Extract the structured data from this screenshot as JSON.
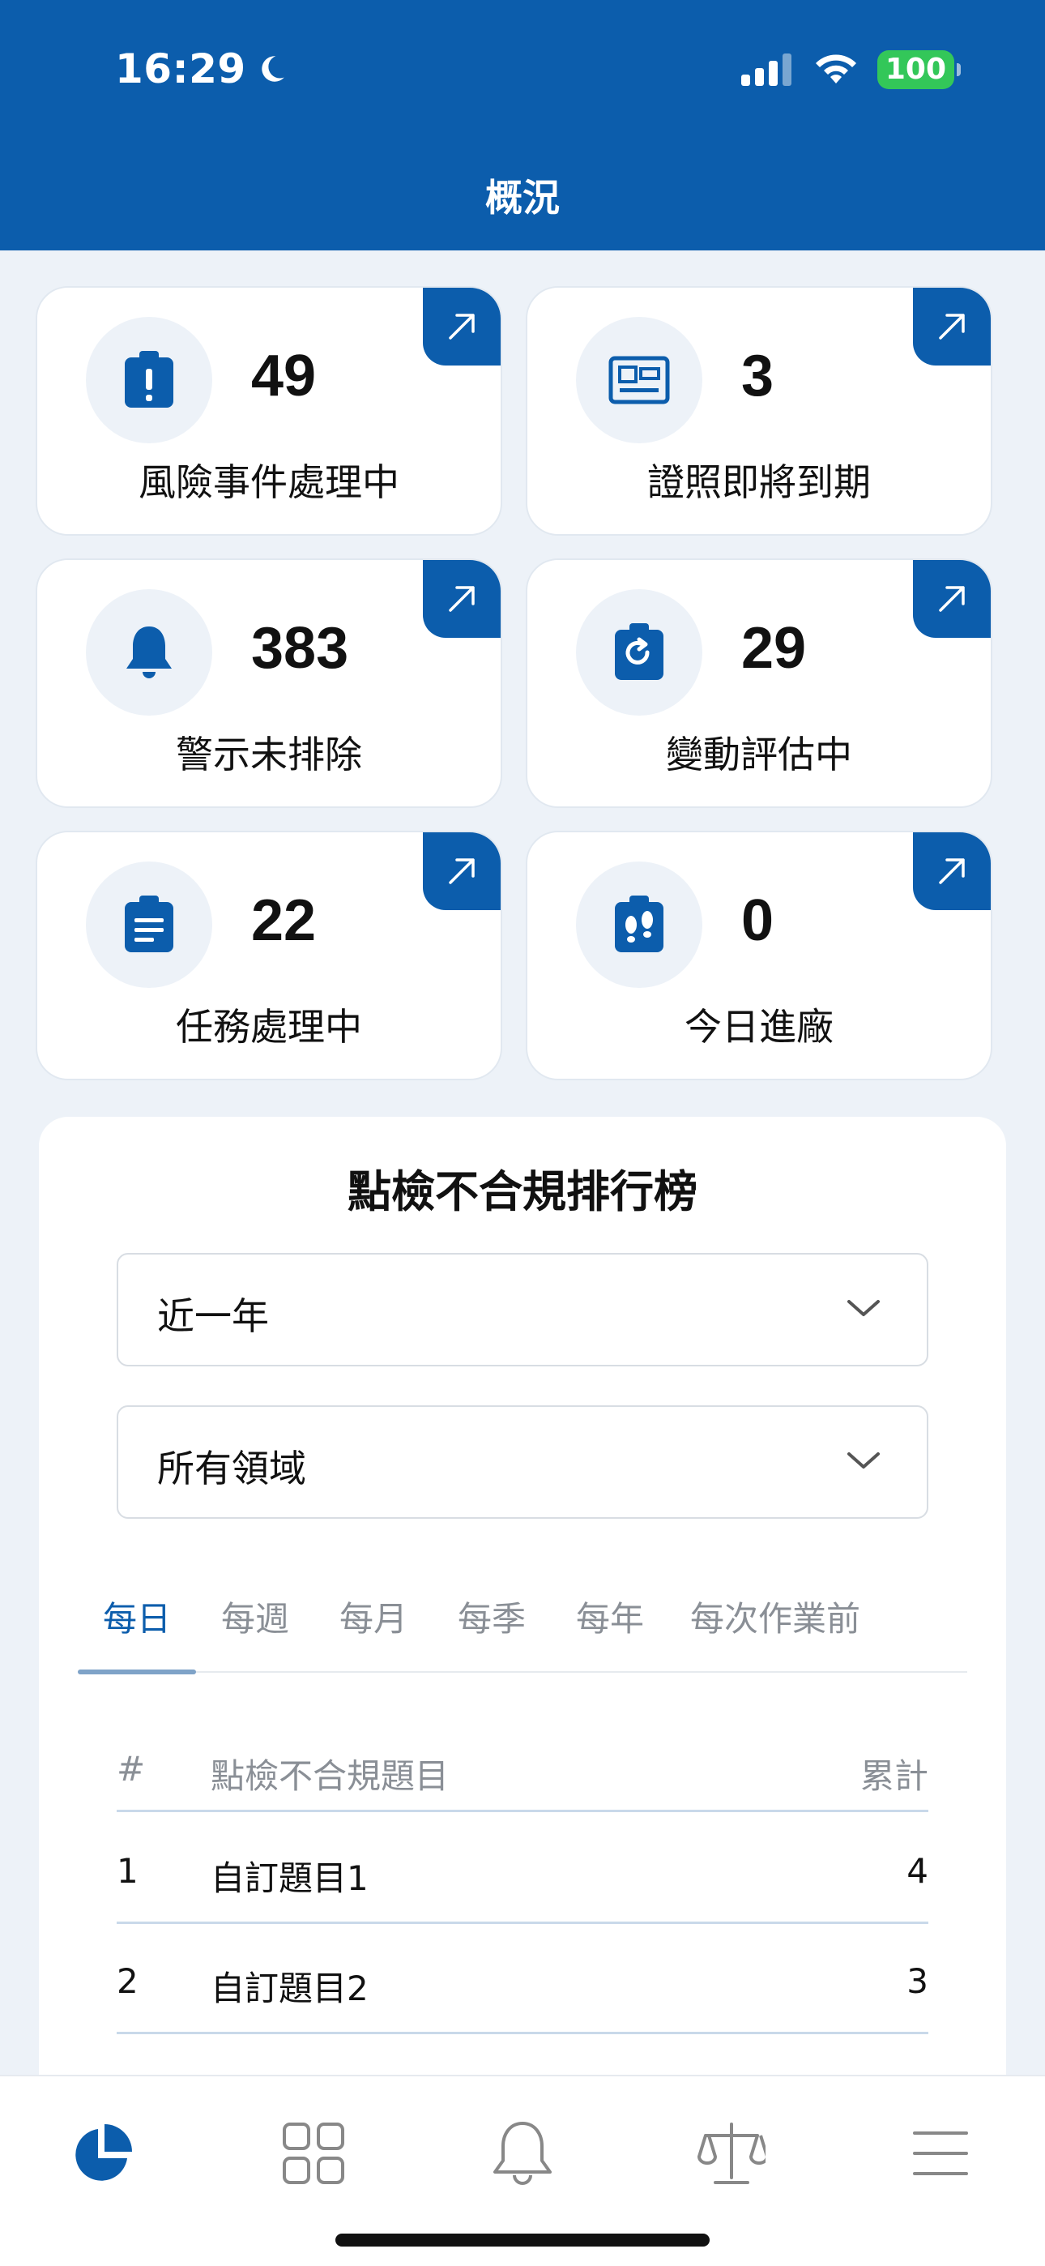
{
  "status_bar": {
    "time": "16:29",
    "battery": "100"
  },
  "header": {
    "title": "概況"
  },
  "stats": [
    {
      "value": "49",
      "label": "風險事件處理中",
      "icon": "alert-clipboard-icon"
    },
    {
      "value": "3",
      "label": "證照即將到期",
      "icon": "id-card-icon"
    },
    {
      "value": "383",
      "label": "警示未排除",
      "icon": "bell-icon"
    },
    {
      "value": "29",
      "label": "變動評估中",
      "icon": "refresh-clipboard-icon"
    },
    {
      "value": "22",
      "label": "任務處理中",
      "icon": "task-clipboard-icon"
    },
    {
      "value": "0",
      "label": "今日進廠",
      "icon": "footprints-badge-icon"
    }
  ],
  "ranking": {
    "title": "點檢不合規排行榜",
    "period_select": "近一年",
    "domain_select": "所有領域",
    "tabs": [
      "每日",
      "每週",
      "每月",
      "每季",
      "每年",
      "每次作業前"
    ],
    "active_tab": "每日",
    "columns": {
      "num": "#",
      "title": "點檢不合規題目",
      "total": "累計"
    },
    "rows": [
      {
        "num": "1",
        "title": "自訂題目1",
        "total": "4"
      },
      {
        "num": "2",
        "title": "自訂題目2",
        "total": "3"
      }
    ]
  },
  "bottom_nav": [
    "overview-icon",
    "apps-grid-icon",
    "bell-icon",
    "scale-icon",
    "menu-icon"
  ],
  "colors": {
    "primary": "#0C5DAC",
    "background": "#EDF2F8",
    "battery": "#33C759"
  }
}
